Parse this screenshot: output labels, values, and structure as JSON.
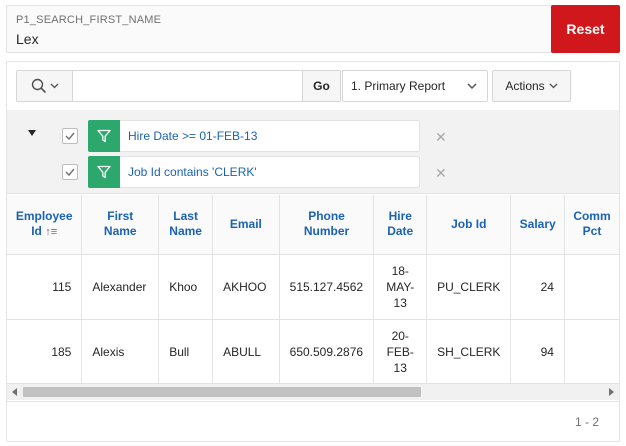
{
  "search_item": {
    "label": "P1_SEARCH_FIRST_NAME",
    "value": "Lex",
    "reset_label": "Reset"
  },
  "toolbar": {
    "search_placeholder": "",
    "go_label": "Go",
    "report_selected": "1. Primary Report",
    "actions_label": "Actions"
  },
  "filters": [
    {
      "text": "Hire Date >= 01-FEB-13",
      "checked": true
    },
    {
      "text": "Job Id contains 'CLERK'",
      "checked": true
    }
  ],
  "table": {
    "columns": [
      "Employee Id",
      "First Name",
      "Last Name",
      "Email",
      "Phone Number",
      "Hire Date",
      "Job Id",
      "Salary",
      "Commission Pct"
    ],
    "columns_lines": [
      [
        "Employee",
        "Id"
      ],
      [
        "First",
        "Name"
      ],
      [
        "Last",
        "Name"
      ],
      [
        "Email"
      ],
      [
        "Phone",
        "Number"
      ],
      [
        "Hire",
        "Date"
      ],
      [
        "Job Id"
      ],
      [
        "Salary"
      ],
      [
        "Comm",
        "Pct"
      ]
    ],
    "rows": [
      {
        "employee_id": "115",
        "first_name": "Alexander",
        "last_name": "Khoo",
        "email": "AKHOO",
        "phone": "515.127.4562",
        "hire_date_lines": [
          "18-",
          "MAY-",
          "13"
        ],
        "job_id": "PU_CLERK",
        "salary": "24",
        "commission": ""
      },
      {
        "employee_id": "185",
        "first_name": "Alexis",
        "last_name": "Bull",
        "email": "ABULL",
        "phone": "650.509.2876",
        "hire_date_lines": [
          "20-",
          "FEB-",
          "13"
        ],
        "job_id": "SH_CLERK",
        "salary": "94",
        "commission": ""
      }
    ]
  },
  "pagination": "1 - 2",
  "colors": {
    "reset_bg": "#d0181c",
    "filter_icon_bg": "#2ca86d",
    "link_blue": "#1a62b8"
  }
}
